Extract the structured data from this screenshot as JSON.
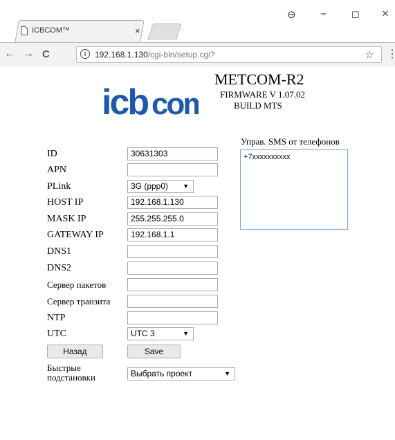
{
  "browser": {
    "tab_title": "ICBCOM™",
    "tab_close": "×",
    "window": {
      "account": "⊖",
      "minimize": "−",
      "maximize": "☐",
      "close": "×"
    },
    "url_host": "192.168.1.130",
    "url_path": "/cgi-bin/setup.cgi?",
    "nav": {
      "back": "←",
      "forward": "→",
      "reload": "C"
    },
    "info_icon": "i",
    "star": "☆",
    "menu": "⋮"
  },
  "header": {
    "logo_text": "icbcom",
    "title": "METCOM-R2",
    "firmware": "FIRMWARE V 1.07.02",
    "build": "BUILD MTS"
  },
  "form": {
    "fields": [
      {
        "label": "ID",
        "value": "30631303"
      },
      {
        "label": "APN",
        "value": ""
      },
      {
        "label": "PLink",
        "value": "3G (ppp0)"
      },
      {
        "label": "HOST IP",
        "value": "192.168.1.130"
      },
      {
        "label": "MASK IP",
        "value": "255.255.255.0"
      },
      {
        "label": "GATEWAY IP",
        "value": "192.168.1.1"
      },
      {
        "label": "DNS1",
        "value": ""
      },
      {
        "label": "DNS2",
        "value": ""
      },
      {
        "label": "Сервер пакетов",
        "value": ""
      },
      {
        "label": "Сервер транзита",
        "value": ""
      },
      {
        "label": "NTP",
        "value": ""
      },
      {
        "label": "UTC",
        "value": "UTC 3"
      }
    ],
    "back_button": "Назад",
    "save_button": "Save",
    "quick_label_1": "Быстрые",
    "quick_label_2": "подстановки",
    "project_select": "Выбрать проект",
    "select_arrow": "▼"
  },
  "sms": {
    "label": "Управ. SMS от телефонов",
    "value": "+7xxxxxxxxxx"
  }
}
